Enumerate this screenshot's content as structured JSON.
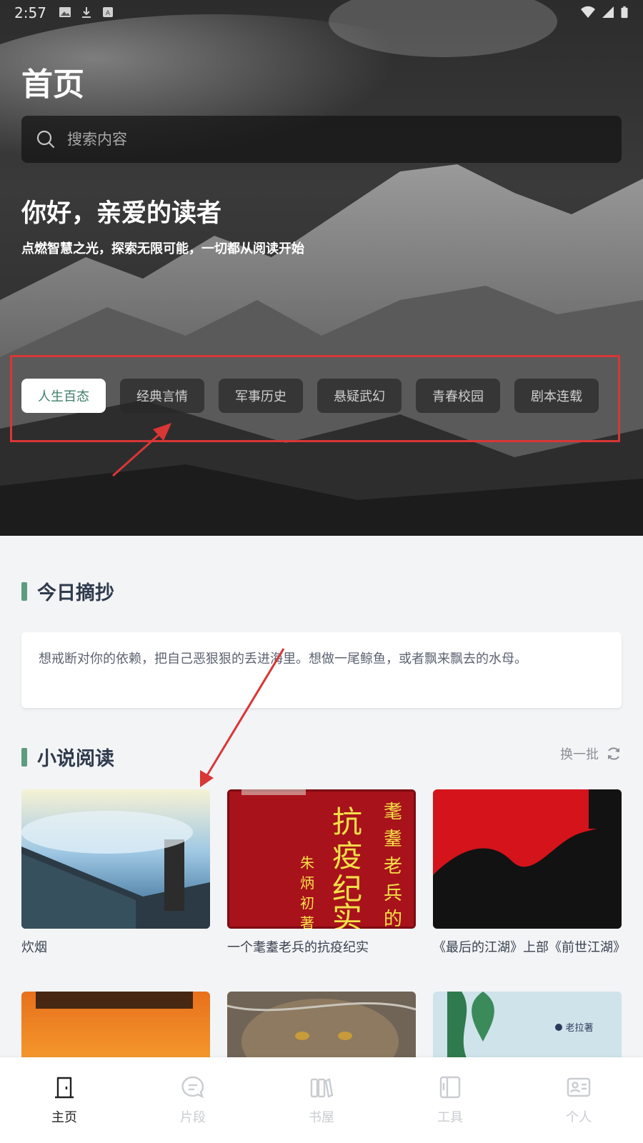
{
  "status_bar": {
    "time": "2:57"
  },
  "header": {
    "title": "首页"
  },
  "search": {
    "placeholder": "搜索内容"
  },
  "greeting": {
    "title": "你好，亲爱的读者",
    "subtitle": "点燃智慧之光，探索无限可能，一切都从阅读开始"
  },
  "categories": [
    {
      "label": "人生百态",
      "active": true
    },
    {
      "label": "经典言情",
      "active": false
    },
    {
      "label": "军事历史",
      "active": false
    },
    {
      "label": "悬疑武幻",
      "active": false
    },
    {
      "label": "青春校园",
      "active": false
    },
    {
      "label": "剧本连载",
      "active": false
    }
  ],
  "daily_excerpt": {
    "title": "今日摘抄",
    "quote": "想戒断对你的依赖，把自己恶狠狠的丢进海里。想做一尾鲸鱼，或者飘来飘去的水母。"
  },
  "novels": {
    "title": "小说阅读",
    "refresh_label": "换一批",
    "books": [
      {
        "title": "炊烟"
      },
      {
        "title": "一个耄耋老兵的抗疫纪实",
        "cover_text": [
          "抗疫纪实",
          "耄耋老兵的",
          "朱炳初",
          "著"
        ]
      },
      {
        "title": "《最后的江湖》上部《前世江湖》"
      }
    ],
    "row2_cover_text": [
      "老拉著"
    ]
  },
  "tabbar": {
    "items": [
      {
        "label": "主页",
        "icon": "door-icon",
        "active": true
      },
      {
        "label": "片段",
        "icon": "chat-bubble-icon",
        "active": false
      },
      {
        "label": "书屋",
        "icon": "books-icon",
        "active": false
      },
      {
        "label": "工具",
        "icon": "tools-icon",
        "active": false
      },
      {
        "label": "个人",
        "icon": "profile-card-icon",
        "active": false
      }
    ]
  },
  "colors": {
    "accent": "#3d7f66",
    "section_bar": "#5c9c80",
    "annotation_red": "#d93636"
  }
}
